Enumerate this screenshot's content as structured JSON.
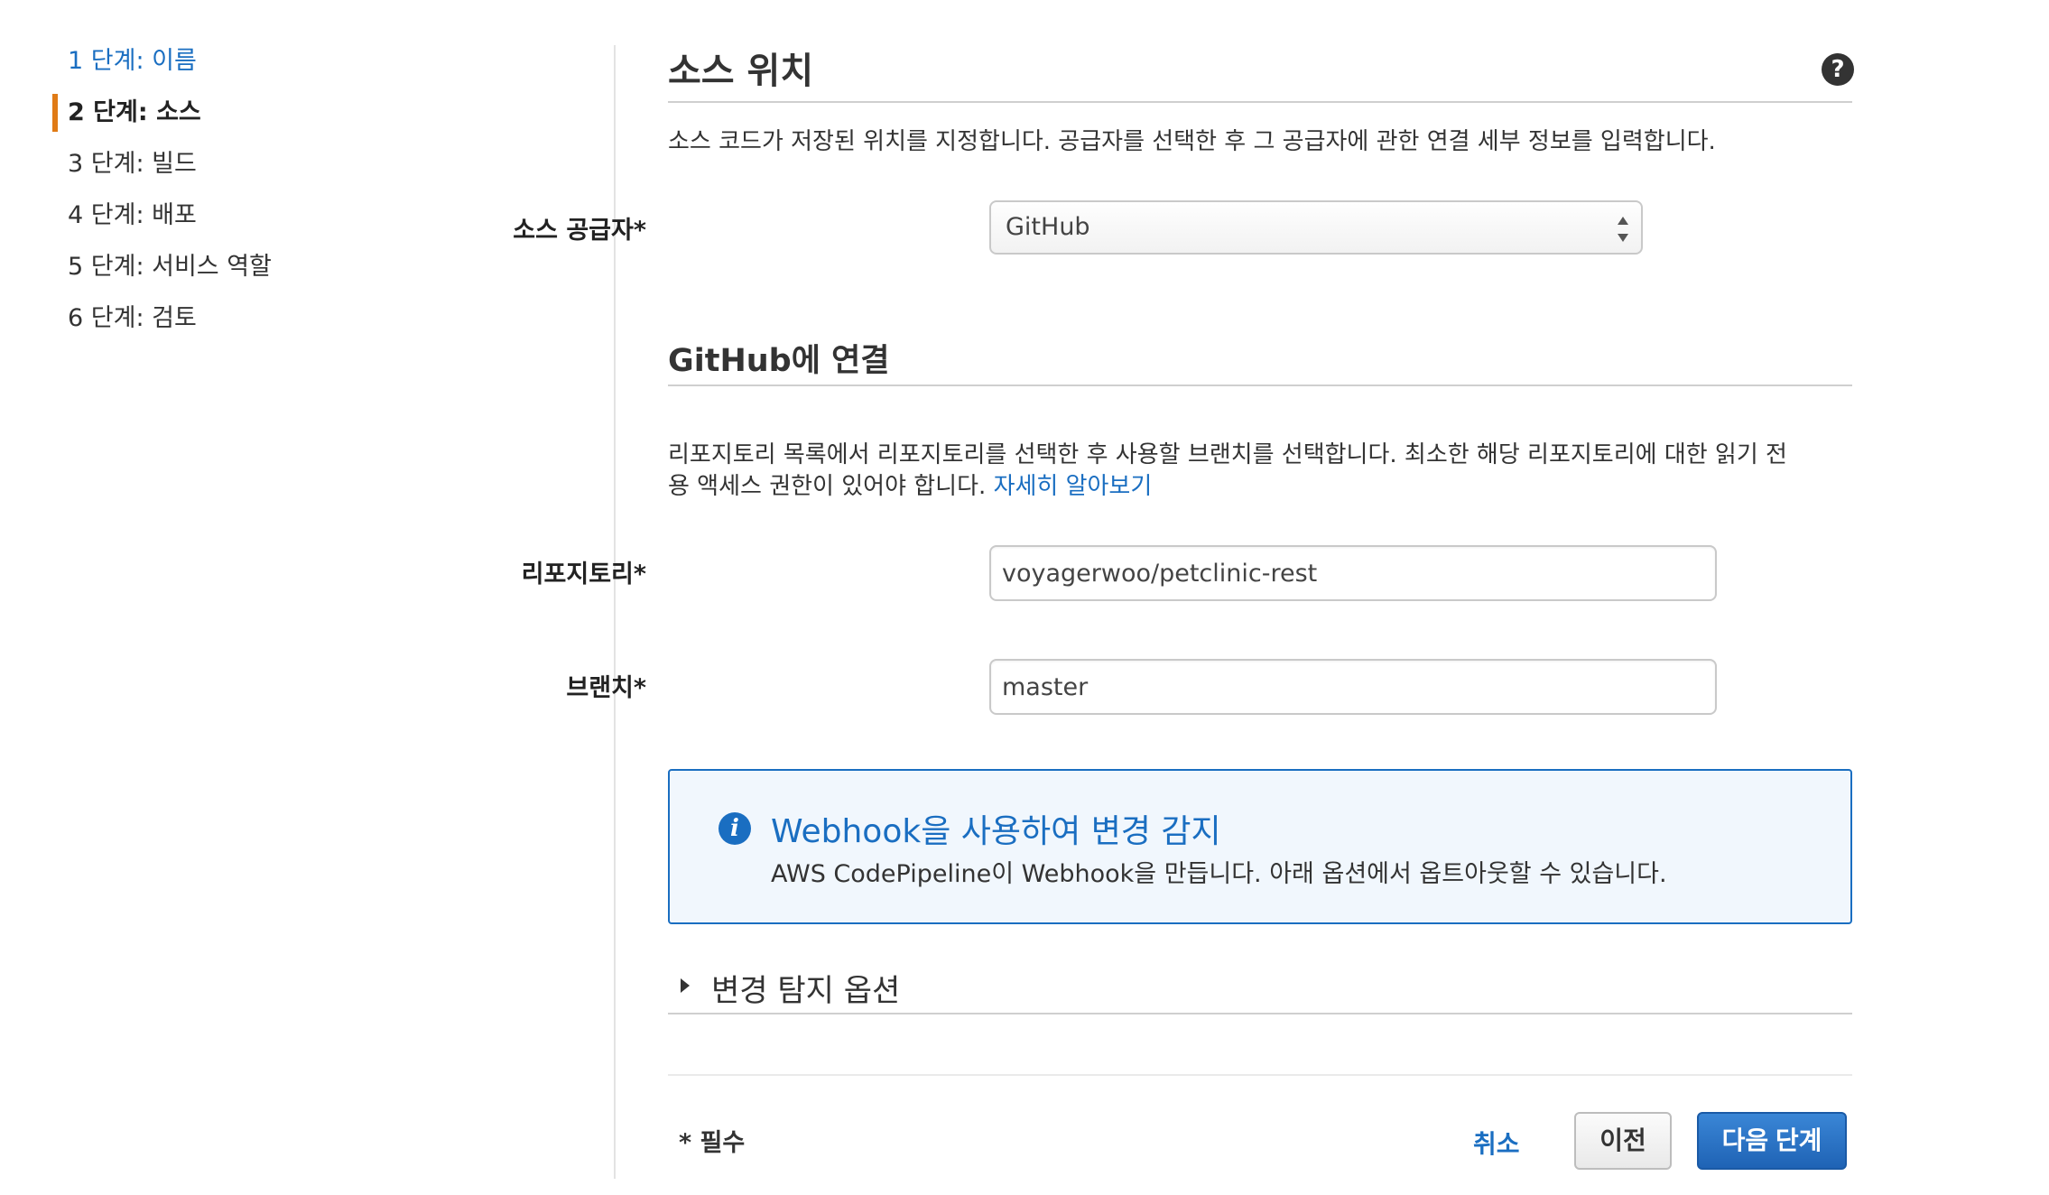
{
  "steps": [
    {
      "label": "1 단계: 이름"
    },
    {
      "label": "2 단계: 소스"
    },
    {
      "label": "3 단계: 빌드"
    },
    {
      "label": "4 단계: 배포"
    },
    {
      "label": "5 단계: 서비스 역할"
    },
    {
      "label": "6 단계: 검토"
    }
  ],
  "source": {
    "title": "소스 위치",
    "help_icon": "?",
    "description": "소스 코드가 저장된 위치를 지정합니다. 공급자를 선택한 후 그 공급자에 관한 연결 세부 정보를 입력합니다.",
    "provider_label": "소스 공급자*",
    "provider_value": "GitHub"
  },
  "github": {
    "title": "GitHub에 연결",
    "description_line1": "리포지토리 목록에서 리포지토리를 선택한 후 사용할 브랜치를 선택합니다. 최소한 해당 리포지토리에 대한 읽기 전",
    "description_line2": "용 액세스 권한이 있어야 합니다.",
    "learn_more": "자세히 알아보기",
    "repo_label": "리포지토리*",
    "repo_value": "voyagerwoo/petclinic-rest",
    "branch_label": "브랜치*",
    "branch_value": "master"
  },
  "info": {
    "icon": "i",
    "title": "Webhook을 사용하여 변경 감지",
    "text": "AWS CodePipeline이 Webhook을 만듭니다. 아래 옵션에서 옵트아웃할 수 있습니다."
  },
  "expander": {
    "label": "변경 탐지 옵션"
  },
  "footer": {
    "required": "* 필수",
    "cancel": "취소",
    "previous": "이전",
    "next": "다음 단계"
  },
  "colors": {
    "accent": "#1a6ec1",
    "active_step_marker": "#e07b16",
    "info_bg": "#f1f7fd"
  }
}
